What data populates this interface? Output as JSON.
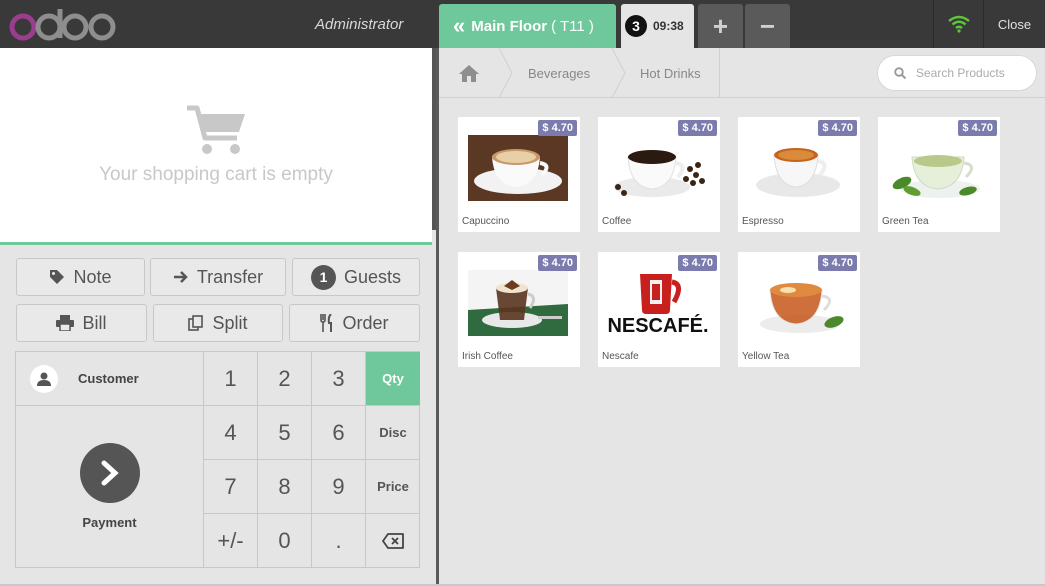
{
  "topbar": {
    "brand": "odoo",
    "user": "Administrator",
    "floor_label": "Main Floor",
    "table_label": "( T11 )",
    "order_count": "3",
    "order_time": "09:38",
    "add_label": "+",
    "remove_label": "−",
    "close_label": "Close"
  },
  "cart": {
    "empty_text": "Your shopping cart is empty"
  },
  "controls": {
    "note": "Note",
    "transfer": "Transfer",
    "guests_count": "1",
    "guests": "Guests",
    "bill": "Bill",
    "split": "Split",
    "order": "Order"
  },
  "numpad": {
    "customer": "Customer",
    "payment": "Payment",
    "keys": [
      "1",
      "2",
      "3",
      "4",
      "5",
      "6",
      "7",
      "8",
      "9",
      "+/-",
      "0",
      "."
    ],
    "modes": [
      "Qty",
      "Disc",
      "Price"
    ],
    "active_mode": "Qty"
  },
  "breadcrumb": {
    "items": [
      "Beverages",
      "Hot Drinks"
    ]
  },
  "search": {
    "placeholder": "Search Products"
  },
  "products": [
    {
      "name": "Capuccino",
      "price": "$ 4.70"
    },
    {
      "name": "Coffee",
      "price": "$ 4.70"
    },
    {
      "name": "Espresso",
      "price": "$ 4.70"
    },
    {
      "name": "Green Tea",
      "price": "$ 4.70"
    },
    {
      "name": "Irish Coffee",
      "price": "$ 4.70"
    },
    {
      "name": "Nescafe",
      "price": "$ 4.70"
    },
    {
      "name": "Yellow Tea",
      "price": "$ 4.70"
    }
  ],
  "colors": {
    "accent": "#6ec89b",
    "topbar": "#393939",
    "price_badge": "#7c7bad",
    "logo_purple": "#9b3d8f",
    "logo_grey": "#8e8e8e",
    "wifi": "#5ec43c"
  }
}
